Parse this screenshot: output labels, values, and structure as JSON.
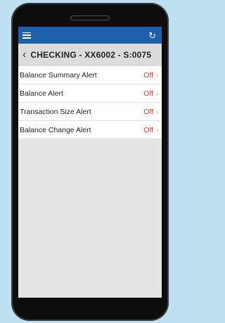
{
  "topbar": {
    "menu_icon": "hamburger-icon",
    "refresh_icon": "refresh-icon"
  },
  "header": {
    "back_icon": "chevron-left-icon",
    "title": "CHECKING - XX6002 - S:0075"
  },
  "alerts": [
    {
      "label": "Balance Summary Alert",
      "status": "Off"
    },
    {
      "label": "Balance Alert",
      "status": "Off"
    },
    {
      "label": "Transaction Size Alert",
      "status": "Off"
    },
    {
      "label": "Balance Change Alert",
      "status": "Off"
    }
  ],
  "colors": {
    "topbar": "#1f5fae",
    "status_off": "#d23b2f",
    "background": "#bfe0f0"
  }
}
